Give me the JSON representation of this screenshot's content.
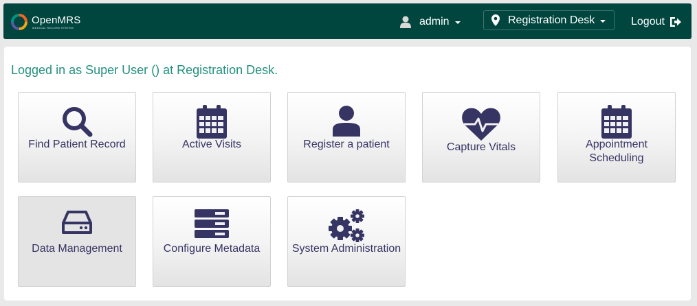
{
  "header": {
    "brand": "OpenMRS",
    "brand_tagline": "MEDICAL RECORD SYSTEM",
    "user_label": "admin",
    "location_label": "Registration Desk",
    "logout_label": "Logout"
  },
  "welcome_message": "Logged in as Super User () at Registration Desk.",
  "apps": [
    {
      "label": "Find Patient Record",
      "icon": "search-icon"
    },
    {
      "label": "Active Visits",
      "icon": "calendar-icon"
    },
    {
      "label": "Register a patient",
      "icon": "user-icon"
    },
    {
      "label": "Capture Vitals",
      "icon": "heart-pulse-icon"
    },
    {
      "label": "Appointment Scheduling",
      "icon": "calendar-icon"
    },
    {
      "label": "Data Management",
      "icon": "hdd-icon"
    },
    {
      "label": "Configure Metadata",
      "icon": "server-icon"
    },
    {
      "label": "System Administration",
      "icon": "gears-icon"
    }
  ],
  "colors": {
    "header_bg": "#00463f",
    "accent": "#22907e",
    "icon": "#363463",
    "page_bg": "#e9e9e9"
  }
}
